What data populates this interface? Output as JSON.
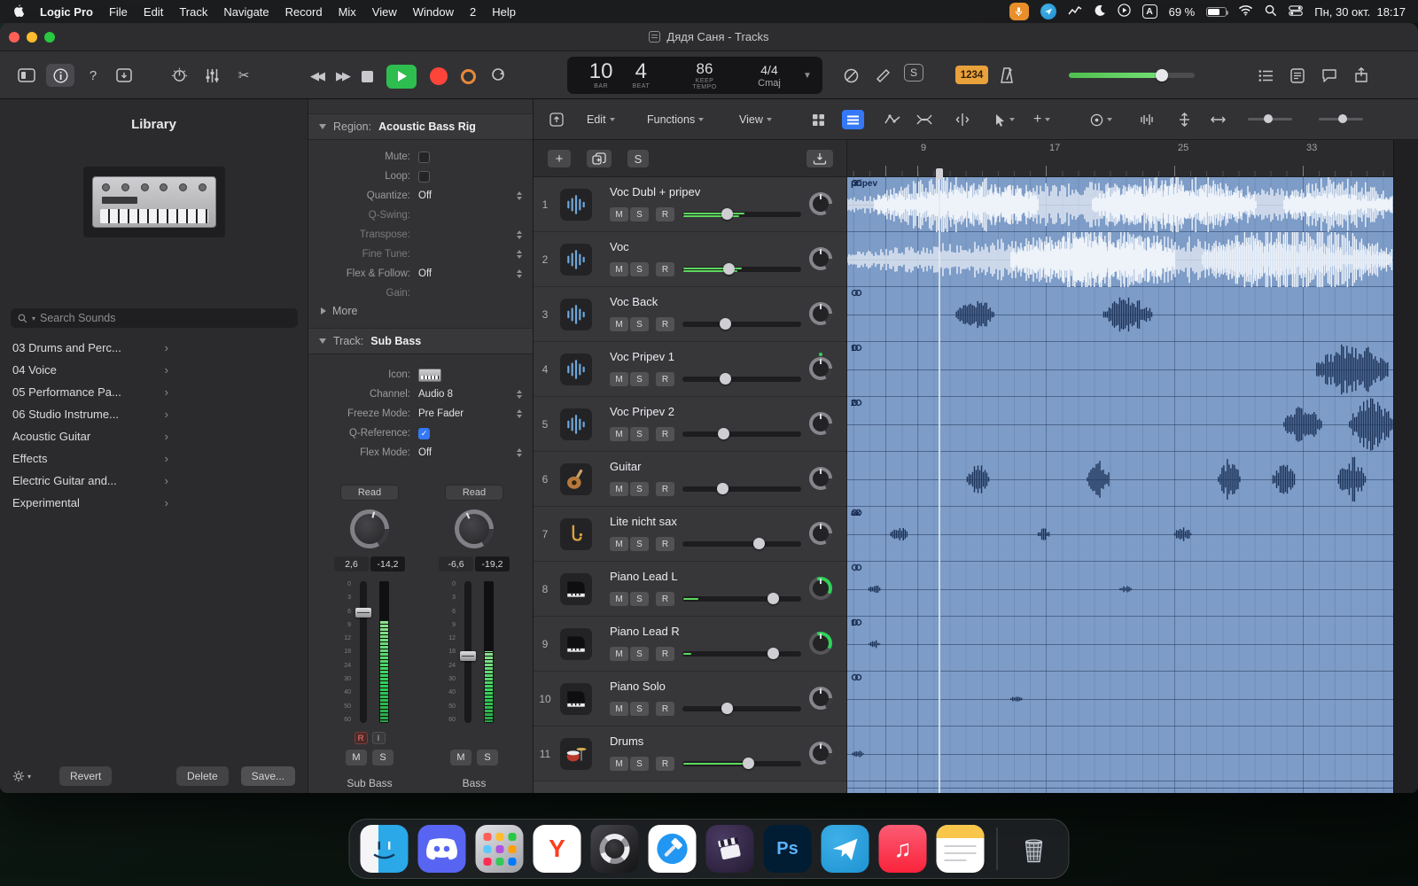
{
  "colors": {
    "accent_green": "#30d158",
    "record_red": "#ff453a",
    "region_blue": "#7d9cc7",
    "count_orange": "#e9a13b",
    "select_blue": "#3478f6",
    "meter_green": "#5dd95d"
  },
  "menubar": {
    "app_name": "Logic Pro",
    "items": [
      "File",
      "Edit",
      "Track",
      "Navigate",
      "Record",
      "Mix",
      "View",
      "Window",
      "2",
      "Help"
    ],
    "battery_percent": "69 %",
    "input_badge": "A",
    "clock": "Пн, 30 окт.  18:17"
  },
  "titlebar": {
    "title": "Дядя Саня - Tracks"
  },
  "toolbar": {
    "lcd": {
      "bar": "10",
      "beat": "4",
      "bar_label": "BAR",
      "beat_label": "BEAT",
      "tempo": "86",
      "tempo_label_1": "KEEP",
      "tempo_label_2": "TEMPO",
      "timesig": "4/4",
      "key": "Cmaj"
    },
    "count_in_badge": "1234",
    "s_badge": "S"
  },
  "library": {
    "title": "Library",
    "search_placeholder": "Search Sounds",
    "items": [
      "03 Drums and Perc...",
      "04 Voice",
      "05 Performance Pa...",
      "06 Studio Instrume...",
      "Acoustic Guitar",
      "Effects",
      "Electric Guitar and...",
      "Experimental"
    ],
    "revert_label": "Revert",
    "delete_label": "Delete",
    "save_label": "Save..."
  },
  "inspector": {
    "region_header": "Region:",
    "region_name": "Acoustic Bass Rig",
    "region_rows": [
      {
        "label": "Mute:",
        "type": "checkbox",
        "checked": false
      },
      {
        "label": "Loop:",
        "type": "checkbox",
        "checked": false
      },
      {
        "label": "Quantize:",
        "value": "Off",
        "stepper": true
      },
      {
        "label": "Q-Swing:",
        "value": "",
        "dim": true
      },
      {
        "label": "Transpose:",
        "value": "",
        "stepper": true,
        "dim": true
      },
      {
        "label": "Fine Tune:",
        "value": "",
        "stepper": true,
        "dim": true
      },
      {
        "label": "Flex & Follow:",
        "value": "Off",
        "stepper": true
      },
      {
        "label": "Gain:",
        "value": "",
        "dim": true
      }
    ],
    "more_label": "More",
    "track_header": "Track:",
    "track_name": "Sub Bass",
    "track_rows": [
      {
        "label": "Icon:",
        "type": "icon"
      },
      {
        "label": "Channel:",
        "value": "Audio 8",
        "stepper": true
      },
      {
        "label": "Freeze Mode:",
        "value": "Pre Fader",
        "stepper": true
      },
      {
        "label": "Q-Reference:",
        "type": "checkbox",
        "checked": true
      },
      {
        "label": "Flex Mode:",
        "value": "Off",
        "stepper": true
      }
    ],
    "fader_scale": [
      "0",
      "3",
      "6",
      "9",
      "12",
      "18",
      "24",
      "30",
      "40",
      "50",
      "60"
    ],
    "mute_label": "M",
    "solo_label": "S",
    "rec_label": "R",
    "input_label": "I",
    "strips": [
      {
        "automation": "Read",
        "pan": "2,6",
        "level": "-14,2",
        "name": "Sub Bass",
        "fader_pos": 0.2,
        "meter": 0.72,
        "knob_angle": 15,
        "rec_buttons": true
      },
      {
        "automation": "Read",
        "pan": "-6,6",
        "level": "-19,2",
        "name": "Bass",
        "fader_pos": 0.55,
        "meter": 0.5,
        "knob_angle": -25,
        "rec_buttons": false
      }
    ]
  },
  "arrange": {
    "menus": [
      "Edit",
      "Functions",
      "View"
    ],
    "ruler_numbers": [
      "9",
      "17",
      "25",
      "33"
    ],
    "playhead_frac": 0.167,
    "tracklist_add": "+",
    "tracklist_solo": "S",
    "mute_label": "M",
    "solo_label": "S",
    "record_label": "R",
    "tracks": [
      {
        "num": "1",
        "name": "Voc Dubl + pripev",
        "icon": "waveform",
        "slider": 0.36,
        "meter": 0.52,
        "stereo_meter": true,
        "knob": "plain",
        "region_label": "pripev",
        "region_icon": true,
        "wave": {
          "color": "#eef3fa",
          "clusters": [
            [
              0,
              1,
              0.42
            ],
            [
              0.05,
              0.35,
              0.6
            ],
            [
              0.45,
              0.75,
              0.6
            ],
            [
              0.8,
              1,
              0.55
            ]
          ]
        }
      },
      {
        "num": "2",
        "name": "Voc",
        "icon": "waveform",
        "slider": 0.38,
        "meter": 0.5,
        "stereo_meter": true,
        "knob": "plain",
        "region_label": "",
        "region_icon": false,
        "wave": {
          "color": "#eef3fa",
          "clusters": [
            [
              0,
              1,
              0.45
            ],
            [
              0.3,
              0.6,
              0.65
            ],
            [
              0.65,
              1,
              0.7
            ]
          ]
        }
      },
      {
        "num": "3",
        "name": "Voc Back",
        "icon": "waveform",
        "slider": 0.35,
        "meter": 0,
        "knob": "plain",
        "region_label": "",
        "region_icon": true,
        "wave": {
          "color": "#1c3258",
          "clusters": [
            [
              0.2,
              0.27,
              0.3
            ],
            [
              0.47,
              0.56,
              0.35
            ]
          ]
        }
      },
      {
        "num": "4",
        "name": "Voc Pripev 1",
        "icon": "waveform",
        "slider": 0.35,
        "meter": 0,
        "knob": "dot",
        "region_label": "1",
        "region_icon": true,
        "wave": {
          "color": "#1c3258",
          "clusters": [
            [
              0.86,
              0.99,
              0.5
            ]
          ]
        }
      },
      {
        "num": "5",
        "name": "Voc Pripev 2",
        "icon": "waveform",
        "slider": 0.33,
        "meter": 0,
        "knob": "plain",
        "region_label": "2",
        "region_icon": true,
        "wave": {
          "color": "#1c3258",
          "clusters": [
            [
              0.8,
              0.87,
              0.4
            ],
            [
              0.92,
              1,
              0.5
            ]
          ]
        }
      },
      {
        "num": "6",
        "name": "Guitar",
        "icon": "guitar",
        "slider": 0.32,
        "meter": 0,
        "knob": "plain",
        "region_label": "",
        "region_icon": false,
        "wave": {
          "color": "#1c3258",
          "clusters": [
            [
              0.22,
              0.26,
              0.3
            ],
            [
              0.44,
              0.48,
              0.35
            ],
            [
              0.68,
              0.72,
              0.4
            ],
            [
              0.78,
              0.82,
              0.3
            ],
            [
              0.9,
              0.95,
              0.45
            ]
          ]
        }
      },
      {
        "num": "7",
        "name": "Lite nicht sax",
        "icon": "sax",
        "slider": 0.66,
        "meter": 0,
        "knob": "plain",
        "region_label": "ax",
        "region_icon": true,
        "wave": {
          "color": "#1c3258",
          "clusters": [
            [
              0.08,
              0.11,
              0.15
            ],
            [
              0.35,
              0.37,
              0.12
            ],
            [
              0.6,
              0.63,
              0.15
            ]
          ]
        }
      },
      {
        "num": "8",
        "name": "Piano Lead L",
        "icon": "piano",
        "slider": 0.79,
        "meter": 0.13,
        "knob": "green",
        "region_label": "",
        "region_icon": true,
        "wave": {
          "color": "#1c3258",
          "clusters": [
            [
              0.04,
              0.06,
              0.1
            ],
            [
              0.5,
              0.52,
              0.08
            ]
          ]
        }
      },
      {
        "num": "9",
        "name": "Piano Lead R",
        "icon": "piano",
        "slider": 0.79,
        "meter": 0.07,
        "knob": "green",
        "region_label": "1",
        "region_icon": true,
        "wave": {
          "color": "#1c3258",
          "clusters": [
            [
              0.04,
              0.06,
              0.08
            ]
          ]
        }
      },
      {
        "num": "10",
        "name": "Piano Solo",
        "icon": "piano",
        "slider": 0.36,
        "meter": 0,
        "knob": "plain",
        "region_label": "",
        "region_icon": true,
        "wave": {
          "color": "#1c3258",
          "clusters": [
            [
              0.3,
              0.32,
              0.08
            ]
          ]
        }
      },
      {
        "num": "11",
        "name": "Drums",
        "icon": "drums",
        "slider": 0.56,
        "meter": 0.55,
        "knob": "plain",
        "region_label": "",
        "region_icon": false,
        "wave": {
          "color": "#1c3258",
          "clusters": [
            [
              0.01,
              0.03,
              0.08
            ]
          ]
        }
      }
    ]
  },
  "dock": {
    "items": [
      {
        "name": "finder"
      },
      {
        "name": "discord"
      },
      {
        "name": "launchpad"
      },
      {
        "name": "yandex-browser",
        "label": "Y"
      },
      {
        "name": "logic-pro"
      },
      {
        "name": "xcode"
      },
      {
        "name": "final-cut"
      },
      {
        "name": "photoshop",
        "label": "Ps"
      },
      {
        "name": "telegram"
      },
      {
        "name": "music"
      },
      {
        "name": "notes"
      },
      {
        "name": "trash"
      }
    ]
  }
}
